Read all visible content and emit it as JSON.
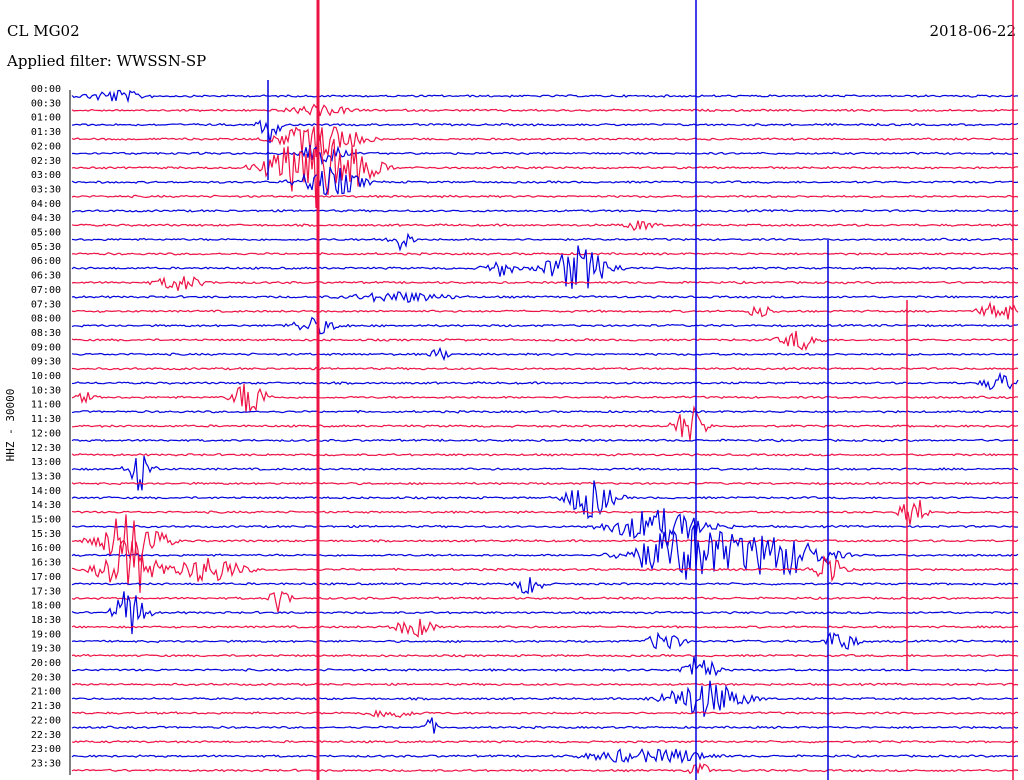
{
  "header": {
    "station": "CL MG02",
    "date": "2018-06-22",
    "filter": "Applied filter: WWSSN-SP"
  },
  "chart_data": {
    "type": "line",
    "title": "CL MG02",
    "subtitle": "Applied filter: WWSSN-SP",
    "date": "2018-06-22",
    "ylabel": "HHZ - 30000",
    "row_labels": [
      "00:00",
      "00:30",
      "01:00",
      "01:30",
      "02:00",
      "02:30",
      "03:00",
      "03:30",
      "04:00",
      "04:30",
      "05:00",
      "05:30",
      "06:00",
      "06:30",
      "07:00",
      "07:30",
      "08:00",
      "08:30",
      "09:00",
      "09:30",
      "10:00",
      "10:30",
      "11:00",
      "11:30",
      "12:00",
      "12:30",
      "13:00",
      "13:30",
      "14:00",
      "14:30",
      "15:00",
      "15:30",
      "16:00",
      "16:30",
      "17:00",
      "17:30",
      "18:00",
      "18:30",
      "19:00",
      "19:30",
      "20:00",
      "20:30",
      "21:00",
      "21:30",
      "22:00",
      "22:30",
      "23:00",
      "23:30"
    ],
    "series_colors": [
      "#0000dd",
      "#ee1144"
    ],
    "color_pattern": "alternating rows: blue, red",
    "x_window_minutes": 30,
    "grid": false
  }
}
